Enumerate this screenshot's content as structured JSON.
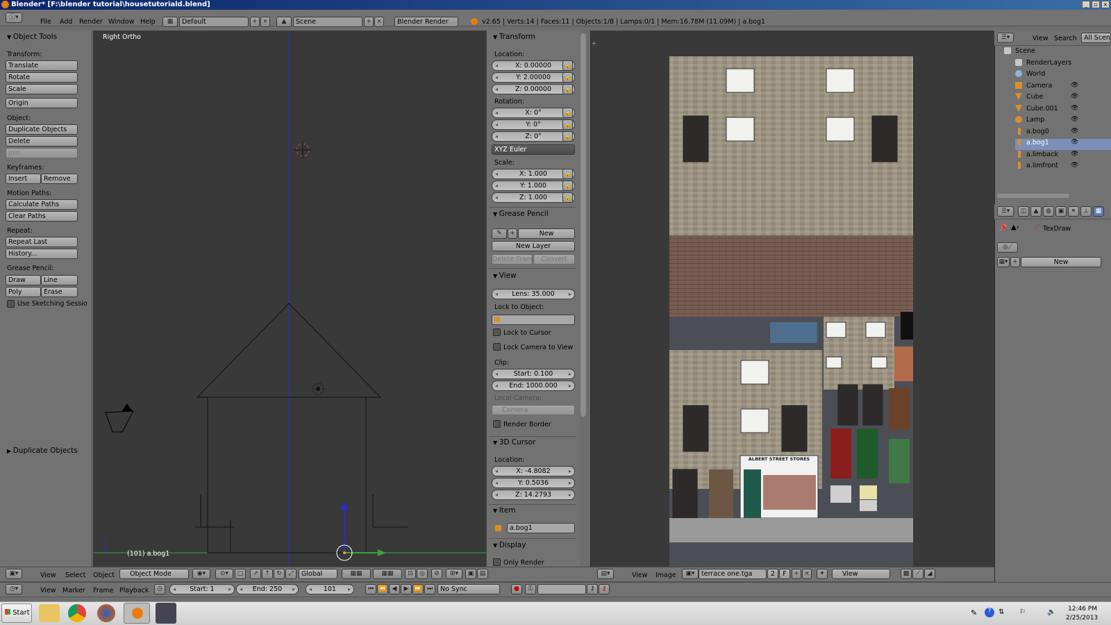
{
  "window": {
    "title": "Blender* [F:\\blender tutorial\\housetutoriald.blend]"
  },
  "menu": {
    "items": [
      "File",
      "Add",
      "Render",
      "Window",
      "Help"
    ],
    "layout": "Default",
    "scene": "Scene",
    "engine": "Blender Render",
    "stats": "v2.65 | Verts:14 | Faces:11 | Objects:1/8 | Lamps:0/1 | Mem:16.78M (11.09M) | a.bog1"
  },
  "tools": {
    "header": "Object Tools",
    "transform_label": "Transform:",
    "translate": "Translate",
    "rotate": "Rotate",
    "scale": "Scale",
    "origin": "Origin",
    "object_label": "Object:",
    "duplicate": "Duplicate Objects",
    "delete": "Delete",
    "join": "Join",
    "keyframes_label": "Keyframes:",
    "insert": "Insert",
    "remove": "Remove",
    "motion_label": "Motion Paths:",
    "calculate": "Calculate Paths",
    "clear": "Clear Paths",
    "repeat_label": "Repeat:",
    "repeat_last": "Repeat Last",
    "history": "History...",
    "grease_label": "Grease Pencil:",
    "draw": "Draw",
    "line": "Line",
    "poly": "Poly",
    "erase": "Erase",
    "sketching": "Use Sketching Sessio",
    "duplicate_panel": "Duplicate Objects"
  },
  "viewport": {
    "view_name": "Right Ortho",
    "object_label": "(101) a.bog1"
  },
  "properties": {
    "transform_header": "Transform",
    "location_label": "Location:",
    "loc": [
      "X: 0.00000",
      "Y: 2.00000",
      "Z: 0.00000"
    ],
    "rotation_label": "Rotation:",
    "rot": [
      "X: 0°",
      "Y: 0°",
      "Z: 0°"
    ],
    "rotation_mode": "XYZ Euler",
    "scale_label": "Scale:",
    "scale": [
      "X: 1.000",
      "Y: 1.000",
      "Z: 1.000"
    ],
    "grease_header": "Grease Pencil",
    "gp_new": "New",
    "gp_new_layer": "New Layer",
    "gp_delete_frame": "Delete Frame",
    "gp_convert": "Convert",
    "view_header": "View",
    "lens": "Lens: 35.000",
    "lock_object_label": "Lock to Object:",
    "lock_cursor": "Lock to Cursor",
    "lock_camera": "Lock Camera to View",
    "clip_label": "Clip:",
    "clip_start": "Start: 0.100",
    "clip_end": "End: 1000.000",
    "local_camera_label": "Local Camera:",
    "local_camera": "Camera",
    "render_border": "Render Border",
    "cursor_header": "3D Cursor",
    "cursor_location_label": "Location:",
    "cursor": [
      "X: -4.8082",
      "Y: 0.5036",
      "Z: 14.2793"
    ],
    "item_header": "Item",
    "item_name": "a.bog1",
    "display_header": "Display",
    "only_render": "Only Render"
  },
  "viewport_header": {
    "items": [
      "View",
      "Select",
      "Object"
    ],
    "mode": "Object Mode",
    "orientation": "Global"
  },
  "image_editor": {
    "header_items": [
      "View",
      "Image"
    ],
    "image_name": "terrace one.tga",
    "users": "2",
    "fake": "F",
    "view_mode": "View",
    "shop_sign": "ALBERT STREET STORES"
  },
  "outliner": {
    "header_items": [
      "View",
      "Search"
    ],
    "scope": "All Scene",
    "items": [
      "Scene",
      "RenderLayers",
      "World",
      "Camera",
      "Cube",
      "Cube.001",
      "Lamp",
      "a.bog0",
      "a.bog1",
      "a.limback",
      "a.limfront"
    ]
  },
  "texpaint": {
    "brush": "TexDraw",
    "new": "New"
  },
  "timeline": {
    "items": [
      "View",
      "Marker",
      "Frame",
      "Playback"
    ],
    "start": "Start: 1",
    "end": "End: 250",
    "current": "101",
    "sync": "No Sync"
  },
  "taskbar": {
    "start": "Start",
    "time": "12:46 PM",
    "date": "2/25/2013"
  },
  "colors": {
    "viewport_bg": "#393939",
    "panel_bg": "#727272",
    "title_bar": "#0a246a",
    "selected_row": "#5f7ab0"
  }
}
